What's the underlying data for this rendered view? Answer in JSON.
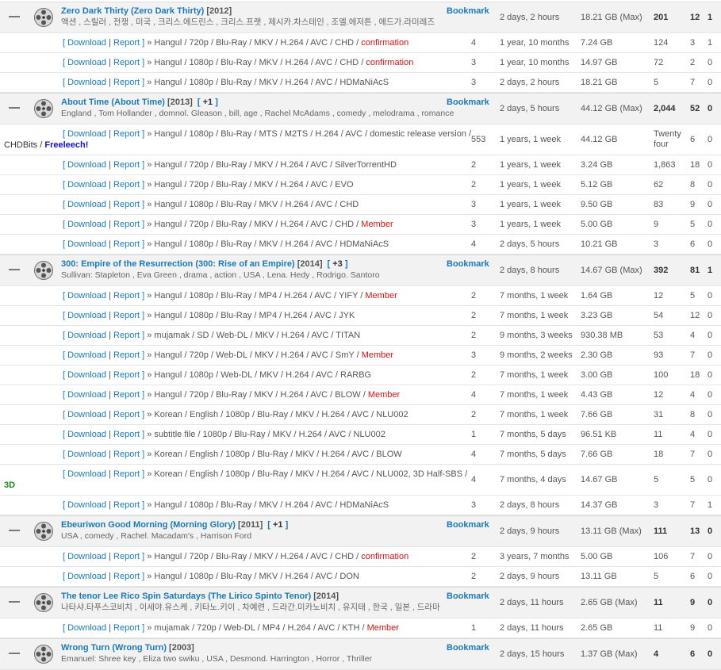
{
  "labels": {
    "download": "Download",
    "report": "Report",
    "bookmark": "Bookmark",
    "sep": "|",
    "arrow": "»"
  },
  "groups": [
    {
      "title": "Zero Dark Thirty (Zero Dark Thirty)",
      "year": "[2012]",
      "extra": "",
      "tags": "액션 , 스릴러 , 전쟁 , 미국 , 크리스.에드린스 , 크리스.프랫 , 제시카.차스테인 , 조엘.에저튼 , 에드가.라미레즈",
      "files": "",
      "time": "2 days, 2 hours",
      "size": "18.21 GB (Max)",
      "snatch": "201",
      "seed": "12",
      "leech": "1",
      "torrents": [
        {
          "desc": "Hangul / 720p / Blu-Ray / MKV / H.264 / AVC / CHD / ",
          "flag": "confirmation",
          "files": "4",
          "time": "1 year, 10 months",
          "size": "7.24 GB",
          "snatch": "124",
          "seed": "3",
          "leech": "1"
        },
        {
          "desc": "Hangul / 1080p / Blu-Ray / MKV / H.264 / AVC / CHD / ",
          "flag": "confirmation",
          "files": "3",
          "time": "1 year, 10 months",
          "size": "14.97 GB",
          "snatch": "72",
          "seed": "2",
          "leech": "0"
        },
        {
          "desc": "Hangul / 1080p / Blu-Ray / MKV / H.264 / AVC / HDMaNiAcS",
          "flag": "",
          "files": "3",
          "time": "2 days, 2 hours",
          "size": "18.21 GB",
          "snatch": "5",
          "seed": "7",
          "leech": "0"
        }
      ]
    },
    {
      "title": "About Time (About Time)",
      "year": "[2013]",
      "extra": "+1",
      "tags": "England , Tom Hollander , domnol. Gleason , bill, age , Rachel McAdams , comedy , melodrama , romance",
      "files": "",
      "time": "2 days, 5 hours",
      "size": "44.12 GB (Max)",
      "snatch": "2,044",
      "seed": "52",
      "leech": "0",
      "torrents": [
        {
          "desc": "Hangul / 1080p / Blu-Ray / MTS / M2TS / H.264 / AVC / domestic release version / ",
          "flag": "",
          "wrap": "CHDBits / ",
          "freeleech": "Freeleech!",
          "files": "553",
          "time": "1 years, 1 week",
          "size": "44.12 GB",
          "snatch": "Twenty four",
          "seed": "6",
          "leech": "0"
        },
        {
          "desc": "Hangul / 720p / Blu-Ray / MKV / H.264 / AVC / SilverTorrentHD",
          "flag": "",
          "files": "2",
          "time": "1 years, 1 week",
          "size": "3.24 GB",
          "snatch": "1,863",
          "seed": "18",
          "leech": "0"
        },
        {
          "desc": "Hangul / 720p / Blu-Ray / MKV / H.264 / AVC / EVO",
          "flag": "",
          "files": "2",
          "time": "1 years, 1 week",
          "size": "5.12 GB",
          "snatch": "62",
          "seed": "8",
          "leech": "0"
        },
        {
          "desc": "Hangul / 1080p / Blu-Ray / MKV / H.264 / AVC / CHD",
          "flag": "",
          "files": "3",
          "time": "1 years, 1 week",
          "size": "9.50 GB",
          "snatch": "83",
          "seed": "9",
          "leech": "0"
        },
        {
          "desc": "Hangul / 720p / Blu-Ray / MKV / H.264 / AVC / CHD / ",
          "flag": "Member",
          "files": "3",
          "time": "1 years, 1 week",
          "size": "5.00 GB",
          "snatch": "9",
          "seed": "5",
          "leech": "0"
        },
        {
          "desc": "Hangul / 1080p / Blu-Ray / MKV / H.264 / AVC / HDMaNiAcS",
          "flag": "",
          "files": "4",
          "time": "2 days, 5 hours",
          "size": "10.21 GB",
          "snatch": "3",
          "seed": "6",
          "leech": "0"
        }
      ]
    },
    {
      "title": "300: Empire of the Resurrection (300: Rise of an Empire)",
      "year": "[2014]",
      "extra": "+3",
      "tags": "Sullivan: Stapleton , Eva Green , drama , action , USA , Lena. Hedy , Rodrigo. Santoro",
      "files": "",
      "time": "2 days, 8 hours",
      "size": "14.67 GB (Max)",
      "snatch": "392",
      "seed": "81",
      "leech": "1",
      "torrents": [
        {
          "desc": "Hangul / 1080p / Blu-Ray / MP4 / H.264 / AVC / YIFY / ",
          "flag": "Member",
          "files": "2",
          "time": "7 months, 1 week",
          "size": "1.64 GB",
          "snatch": "12",
          "seed": "5",
          "leech": "0"
        },
        {
          "desc": "Hangul / 1080p / Blu-Ray / MP4 / H.264 / AVC / JYK",
          "flag": "",
          "files": "2",
          "time": "7 months, 1 week",
          "size": "3.23 GB",
          "snatch": "54",
          "seed": "12",
          "leech": "0"
        },
        {
          "desc": "mujamak / SD / Web-DL / MKV / H.264 / AVC / TITAN",
          "flag": "",
          "files": "2",
          "time": "9 months, 3 weeks",
          "size": "930.38 MB",
          "snatch": "53",
          "seed": "4",
          "leech": "0"
        },
        {
          "desc": "Hangul / 720p / Web-DL / MKV / H.264 / AVC / SmY / ",
          "flag": "Member",
          "files": "3",
          "time": "9 months, 2 weeks",
          "size": "2.30 GB",
          "snatch": "93",
          "seed": "7",
          "leech": "0"
        },
        {
          "desc": "Hangul / 1080p / Web-DL / MKV / H.264 / AVC / RARBG",
          "flag": "",
          "files": "2",
          "time": "7 months, 1 week",
          "size": "3.00 GB",
          "snatch": "100",
          "seed": "18",
          "leech": "0"
        },
        {
          "desc": "Hangul / 720p / Blu-Ray / MKV / H.264 / AVC / BLOW / ",
          "flag": "Member",
          "files": "4",
          "time": "7 months, 1 week",
          "size": "4.43 GB",
          "snatch": "12",
          "seed": "4",
          "leech": "0"
        },
        {
          "desc": "Korean / English / 1080p / Blu-Ray / MKV / H.264 / AVC / NLU002",
          "flag": "",
          "files": "2",
          "time": "7 months, 1 week",
          "size": "7.66 GB",
          "snatch": "31",
          "seed": "8",
          "leech": "0"
        },
        {
          "desc": "subtitle file / 1080p / Blu-Ray / MKV / H.264 / AVC / NLU002",
          "flag": "",
          "files": "1",
          "time": "7 months, 5 days",
          "size": "96.51 KB",
          "snatch": "11",
          "seed": "4",
          "leech": "0"
        },
        {
          "desc": "Korean / English / 1080p / Blu-Ray / MKV / H.264 / AVC / BLOW",
          "flag": "",
          "files": "4",
          "time": "7 months, 5 days",
          "size": "7.66 GB",
          "snatch": "18",
          "seed": "7",
          "leech": "0"
        },
        {
          "desc": "Korean / English / 1080p / Blu-Ray / MKV / H.264 / AVC / NLU002, 3D Half-SBS / ",
          "flag": "",
          "wrap3d": "3D",
          "files": "4",
          "time": "7 months, 4 days",
          "size": "14.67 GB",
          "snatch": "5",
          "seed": "5",
          "leech": "0"
        },
        {
          "desc": "Hangul / 1080p / Blu-Ray / MKV / H.264 / AVC / HDMaNiAcS",
          "flag": "",
          "files": "3",
          "time": "2 days, 8 hours",
          "size": "14.37 GB",
          "snatch": "3",
          "seed": "7",
          "leech": "1"
        }
      ]
    },
    {
      "title": "Ebeuriwon Good Morning (Morning Glory)",
      "year": "[2011]",
      "extra": "+1",
      "tags": "USA , comedy , Rachel. Macadam's , Harrison Ford",
      "files": "",
      "time": "2 days, 9 hours",
      "size": "13.11 GB (Max)",
      "snatch": "111",
      "seed": "13",
      "leech": "0",
      "torrents": [
        {
          "desc": "Hangul / 720p / Blu-Ray / MKV / H.264 / AVC / CHD / ",
          "flag": "confirmation",
          "files": "2",
          "time": "3 years, 7 months",
          "size": "5.00 GB",
          "snatch": "106",
          "seed": "7",
          "leech": "0"
        },
        {
          "desc": "Hangul / 1080p / Blu-Ray / MKV / H.264 / AVC / DON",
          "flag": "",
          "files": "2",
          "time": "2 days, 9 hours",
          "size": "13.11 GB",
          "snatch": "5",
          "seed": "6",
          "leech": "0"
        }
      ]
    },
    {
      "title": "The tenor Lee Rico Spin Saturdays (The Lirico Spinto Tenor)",
      "year": "[2014]",
      "extra": "",
      "tags": "나타샤.타푸스코비치 , 이세야.유스케 , 키타노.키이 , 차예련 , 드라간.미카노비치 , 유지태 , 한국 , 일본 , 드라마",
      "files": "",
      "time": "2 days, 11 hours",
      "size": "2.65 GB (Max)",
      "snatch": "11",
      "seed": "9",
      "leech": "0",
      "torrents": [
        {
          "desc": "mujamak / 720p / Web-DL / MP4 / H.264 / AVC / KTH / ",
          "flag": "Member",
          "files": "1",
          "time": "2 days, 11 hours",
          "size": "2.65 GB",
          "snatch": "11",
          "seed": "9",
          "leech": "0"
        }
      ]
    },
    {
      "title": "Wrong Turn (Wrong Turn)",
      "year": "[2003]",
      "extra": "",
      "tags": "Emanuel: Shree key , Eliza two swiku , USA , Desmond. Harrington , Horror , Thriller",
      "files": "",
      "time": "2 days, 15 hours",
      "size": "1.37 GB (Max)",
      "snatch": "4",
      "seed": "6",
      "leech": "0",
      "torrents": []
    }
  ]
}
